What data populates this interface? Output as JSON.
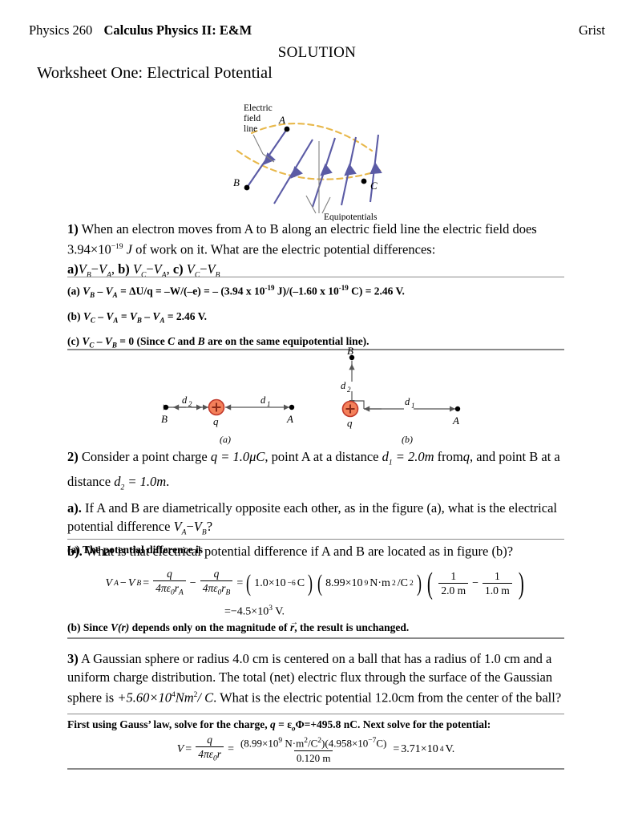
{
  "header": {
    "course_code": "Physics 260",
    "course_title": "Calculus Physics II: E&M",
    "instructor": "Grist",
    "solution_label": "SOLUTION",
    "worksheet_title": "Worksheet One:  Electrical Potential"
  },
  "figure1": {
    "label_line1": "Electric",
    "label_line2": "field",
    "label_line3": "line",
    "label_equipotentials": "Equipotentials",
    "point_a": "A",
    "point_b": "B",
    "point_c": "C",
    "fieldline_color": "#5b5ba5",
    "equipotential_color": "#e8b84b",
    "leader_color": "#808080"
  },
  "q1": {
    "number": "1)",
    "text_a": "When an electron moves from A to B along an electric field line the electric field does 3.94",
    "text_times": "×",
    "text_base": "10",
    "text_exp": "−19",
    "text_unit": "J",
    "text_b": "of work on it. What are the electric potential differences:",
    "parts": {
      "a_label": "a)",
      "a_expr_1": "V",
      "a_sub_1": "B",
      "a_minus": "−",
      "a_expr_2": "V",
      "a_sub_2": "A",
      "b_label": "b)",
      "b_expr_1": "V",
      "b_sub_1": "C",
      "b_expr_2": "V",
      "b_sub_2": "A",
      "c_label": "c)",
      "c_expr_1": "V",
      "c_sub_1": "C",
      "c_expr_2": "V",
      "c_sub_2": "B"
    },
    "answers": {
      "a": "(a) V_B – V_A = ΔU/q = –W/(–e) = – (3.94 x 10-19 J)/(–1.60 x 10-19 C) = 2.46 V.",
      "a_html_pre": "(a) ",
      "a_v1": "V",
      "a_v1s": "B",
      "a_v2": "V",
      "a_v2s": "A",
      "a_mid": " = ΔU/q = –W/(–e) = – (3.94 x 10",
      "a_e1": "-19",
      "a_mid2": " J)/(–1.60 x 10",
      "a_e2": "-19",
      "a_end": " C) = 2.46 V.",
      "b_pre": "(b) ",
      "b_v1": "V",
      "b_v1s": "C",
      "b_v2": "V",
      "b_v2s": "A",
      "b_v3": "V",
      "b_v3s": "B",
      "b_v4": "V",
      "b_v4s": "A",
      "b_end": " = 2.46 V.",
      "c_pre": "(c) ",
      "c_v1": "V",
      "c_v1s": "C",
      "c_v2": "V",
      "c_v2s": "B",
      "c_mid": " = 0 (Since ",
      "c_italic1": "C",
      "c_mid2": " and ",
      "c_italic2": "B",
      "c_end": " are on the same equipotential line)."
    }
  },
  "figure2": {
    "caption_a": "(a)",
    "caption_b": "(b)",
    "point_a": "A",
    "point_b": "B",
    "charge_label": "q",
    "d1_label": "d",
    "d1_sub": "1",
    "d2_label": "d",
    "d2_sub": "2",
    "charge_fill": "#f4805a",
    "charge_stroke": "#c0392b",
    "line_color": "#555555"
  },
  "q2": {
    "number": "2)",
    "lead": "Consider a point charge",
    "q_eq": "q = 1.0μC",
    "mid1": ", point A at a distance",
    "d1_eq_var": "d",
    "d1_eq_sub": "1",
    "d1_eq_val": " = 2.0m",
    "mid2": "from",
    "q_var": "q",
    "mid3": ", and point B at a distance",
    "d2_eq_var": "d",
    "d2_eq_sub": "2",
    "d2_eq_val": " = 1.0m",
    "period": ".",
    "part_a_label": "a).",
    "part_a_text": "If A and B are diametrically opposite each other, as in the figure (a), what is the electrical potential difference",
    "part_a_v1": "V",
    "part_a_v1s": "A",
    "part_a_v2": "V",
    "part_a_v2s": "B",
    "part_a_q": "?",
    "part_b_label": "b).",
    "part_b_text": "What is that electrical potential difference if A and B are located as in figure (b)?",
    "answer_a_heading": "(a) The potential difference is",
    "equation": {
      "lhs_v1": "V",
      "lhs_v1s": "A",
      "lhs_minus": "−",
      "lhs_v2": "V",
      "lhs_v2s": "B",
      "eq1": "=",
      "f1_num": "q",
      "f1_den_pre": "4πε",
      "f1_den_sub": "0",
      "f1_den_r": "r",
      "f1_den_rsub": "A",
      "minus": "−",
      "f2_num": "q",
      "f2_den_pre": "4πε",
      "f2_den_sub": "0",
      "f2_den_r": "r",
      "f2_den_rsub": "B",
      "eq2": "=",
      "term1": "1.0×10",
      "term1_exp": "−6",
      "term1_unit": " C",
      "term2": "8.99×10",
      "term2_exp": "9",
      "term2_unit": " N·m",
      "term2_unit_exp": "2",
      "term2_unit_div": "/C",
      "term2_unit_div_exp": "2",
      "f3_num": "1",
      "f3_den": "2.0 m",
      "f4_num": "1",
      "f4_den": "1.0 m",
      "result_eq": "=",
      "result_val": "−4.5×10",
      "result_exp": "3",
      "result_unit": " V."
    },
    "answer_b_pre": "(b) Since ",
    "answer_b_v": "V",
    "answer_b_r1": "(r)",
    "answer_b_mid": " depends only on the magnitude of ",
    "answer_b_rvec": "r",
    "answer_b_end": ", the result is unchanged."
  },
  "q3": {
    "number": "3)",
    "text_1": "A Gaussian sphere or radius 4.0 cm is centered on a ball that has a radius of 1.0 cm and a uniform charge distribution. The total (net) electric flux through the surface of the Gaussian sphere is",
    "flux_val": "+5.60×10",
    "flux_exp": "4",
    "flux_unit": "Nm",
    "flux_unit_exp": "2",
    "flux_unit_div": "/ C",
    "text_2": ". What is the electric potential 12.0cm from the center of the ball?",
    "answer_heading_pre": "First using Gauss’ law, solve for the charge, ",
    "answer_heading_q": "q",
    "answer_heading_mid": " = ε",
    "answer_heading_sub": "o",
    "answer_heading_end": "Φ=+495.8 nC.  Next solve for the potential:",
    "equation": {
      "lhs_v": "V",
      "eq1": "=",
      "f1_num": "q",
      "f1_den_pre": "4πε",
      "f1_den_sub": "0",
      "f1_den_r": "r",
      "eq2": "=",
      "f2_num_p1": "(8.99×10",
      "f2_num_e1": "9",
      "f2_num_p2": " N·m",
      "f2_num_e2": "2",
      "f2_num_p3": "/C",
      "f2_num_e3": "2",
      "f2_num_p4": ")(4.958×10",
      "f2_num_e4": "−7",
      "f2_num_p5": "C)",
      "f2_den": "0.120 m",
      "eq3": "=",
      "result": "3.71×10",
      "result_exp": "4",
      "result_unit": " V."
    }
  }
}
